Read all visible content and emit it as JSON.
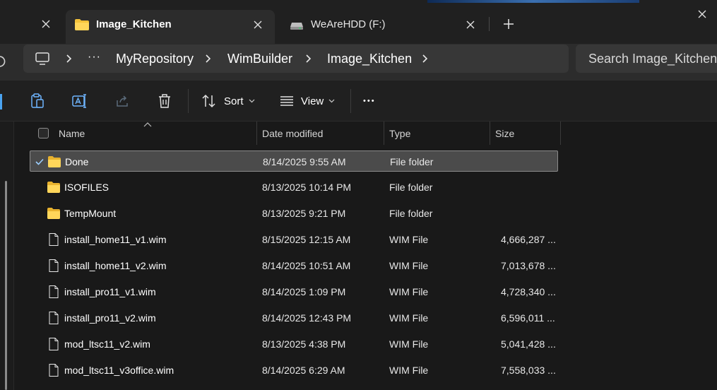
{
  "tabs": [
    {
      "label": "Image_Kitchen",
      "icon": "folder-icon",
      "active": true
    },
    {
      "label": "WeAreHDD (F:)",
      "icon": "drive-icon",
      "active": false
    }
  ],
  "address": {
    "breadcrumbs": [
      "MyRepository",
      "WimBuilder",
      "Image_Kitchen"
    ],
    "overflow_glyph": "···"
  },
  "search": {
    "placeholder": "Search Image_Kitchen"
  },
  "commandbar": {
    "sort_label": "Sort",
    "view_label": "View",
    "more_glyph": "•••"
  },
  "columns": {
    "name": "Name",
    "date": "Date modified",
    "type": "Type",
    "size": "Size"
  },
  "files": [
    {
      "name": "Done",
      "date": "8/14/2025 9:55 AM",
      "type": "File folder",
      "size": "",
      "icon": "folder-icon",
      "selected": true
    },
    {
      "name": "ISOFILES",
      "date": "8/13/2025 10:14 PM",
      "type": "File folder",
      "size": "",
      "icon": "folder-icon",
      "selected": false
    },
    {
      "name": "TempMount",
      "date": "8/13/2025 9:21 PM",
      "type": "File folder",
      "size": "",
      "icon": "folder-icon",
      "selected": false
    },
    {
      "name": "install_home11_v1.wim",
      "date": "8/15/2025 12:15 AM",
      "type": "WIM File",
      "size": "4,666,287 ...",
      "icon": "file-icon",
      "selected": false
    },
    {
      "name": "install_home11_v2.wim",
      "date": "8/14/2025 10:51 AM",
      "type": "WIM File",
      "size": "7,013,678 ...",
      "icon": "file-icon",
      "selected": false
    },
    {
      "name": "install_pro11_v1.wim",
      "date": "8/14/2025 1:09 PM",
      "type": "WIM File",
      "size": "4,728,340 ...",
      "icon": "file-icon",
      "selected": false
    },
    {
      "name": "install_pro11_v2.wim",
      "date": "8/14/2025 12:43 PM",
      "type": "WIM File",
      "size": "6,596,011 ...",
      "icon": "file-icon",
      "selected": false
    },
    {
      "name": "mod_ltsc11_v2.wim",
      "date": "8/13/2025 4:38 PM",
      "type": "WIM File",
      "size": "5,041,428 ...",
      "icon": "file-icon",
      "selected": false
    },
    {
      "name": "mod_ltsc11_v3office.wim",
      "date": "8/14/2025 6:29 AM",
      "type": "WIM File",
      "size": "7,558,033 ...",
      "icon": "file-icon",
      "selected": false
    }
  ],
  "colors": {
    "background": "#191919",
    "titlebar": "#202020",
    "active_tab": "#2c2c2c",
    "selection": "#4b4b4b",
    "folder_yellow": "#f4c23a",
    "accent_blue": "#4aa3f0"
  }
}
